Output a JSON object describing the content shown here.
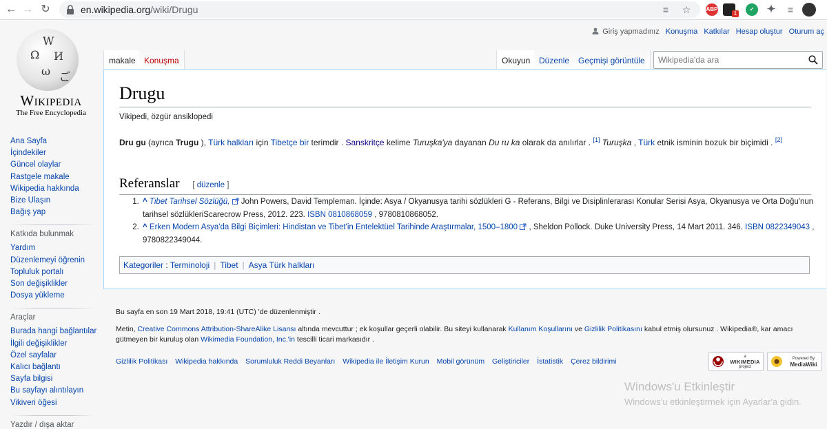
{
  "browser": {
    "url_host": "en.wikipedia.org",
    "url_path": "/wiki/Drugu",
    "extensions": {
      "abp": "ABP",
      "badge_count": "1"
    }
  },
  "logo": {
    "wordmark": "Wikipedia",
    "tagline": "The Free Encyclopedia"
  },
  "personal": {
    "not_logged_in": "Giriş yapmadınız",
    "items": [
      "Konuşma",
      "Katkılar",
      "Hesap oluştur",
      "Oturum aç"
    ]
  },
  "tabs": {
    "left": [
      "makale",
      "Konuşma"
    ],
    "right": [
      "Okuyun",
      "Düzenle",
      "Geçmişi görüntüle"
    ]
  },
  "search": {
    "placeholder": "Wikipedia'da ara"
  },
  "sidebar": {
    "nav": [
      "Ana Sayfa",
      "İçindekiler",
      "Güncel olaylar",
      "Rastgele makale",
      "Wikipedia hakkında",
      "Bize Ulaşın",
      "Bağış yap"
    ],
    "contribute_heading": "Katkıda bulunmak",
    "contribute": [
      "Yardım",
      "Düzenlemeyi öğrenin",
      "Topluluk portalı",
      "Son değişiklikler",
      "Dosya yükleme"
    ],
    "tools_heading": "Araçlar",
    "tools": [
      "Burada hangi bağlantılar",
      "İlgili değişiklikler",
      "Özel sayfalar",
      "Kalıcı bağlantı",
      "Sayfa bilgisi",
      "Bu sayfayı alıntılayın",
      "Vikiveri öğesi"
    ],
    "print_heading": "Yazdır / dışa aktar"
  },
  "article": {
    "title": "Drugu",
    "site_sub": "Vikipedi, özgür ansiklopedi",
    "lead": {
      "b1": "Dru gu",
      "t1": " (ayrıca ",
      "b2": "Trugu",
      "t2": " ), ",
      "l1": "Türk halkları",
      "t3": " için ",
      "l2": "Tibetçe bir",
      "t4": " terimdir . ",
      "l3": "Sanskritçe",
      "t5": " kelime ",
      "i1": "Turuşka'ya",
      "t6": " dayanan ",
      "i2": "Du ru ka",
      "t7": " olarak da anılırlar . ",
      "s1": "[1]",
      "t8": " ",
      "i3": "Turuşka",
      "t9": " , ",
      "l4": "Türk",
      "t10": " etnik isminin bozuk bir biçimidi . ",
      "s2": "[2]"
    },
    "refs_heading": "Referanslar",
    "refs_edit": "düzenle",
    "refs": [
      {
        "caret": "^",
        "link": "Tibet Tarihsel Sözlüğü,",
        "text": " John Powers, David Templeman. İçinde: Asya / Okyanusya tarihi sözlükleri G - Referans, Bilgi ve Disiplinlerarası Konular Serisi Asya, Okyanusya ve Orta Doğu'nun tarihsel sözlükleriScarecrow Press, 2012. 223. ",
        "isbn_label": "ISBN",
        "isbn": "0810868059",
        "tail": " , 9780810868052."
      },
      {
        "caret": "^",
        "link": "Erken Modern Asya'da Bilgi Biçimleri: Hindistan ve Tibet'in Entelektüel Tarihinde Araştırmalar, 1500–1800",
        "text": " , Sheldon Pollock. Duke University Press, 14 Mart 2011. 346. ",
        "isbn_label": "ISBN",
        "isbn": "0822349043",
        "tail": " , 9780822349044."
      }
    ],
    "categories_label": "Kategoriler",
    "categories": [
      "Terminoloji",
      "Tibet",
      "Asya Türk halkları"
    ]
  },
  "footer": {
    "lastmod": "Bu sayfa en son 19 Mart 2018, 19:41  (UTC) 'de düzenlenmiştir .",
    "license_pre": "Metin, ",
    "license_link": "Creative Commons Attribution-ShareAlike Lisansı",
    "license_mid": " altında mevcuttur ; ek koşullar geçerli olabilir. Bu siteyi kullanarak ",
    "terms_link": "Kullanım Koşullarını",
    "license_and": " ve ",
    "privacy_link": "Gizlilik Politikasını",
    "license_end": " kabul etmiş olursunuz . Wikipedia®, kar amacı gütmeyen bir kuruluş olan ",
    "wmf_link": "Wikimedia Foundation, Inc.'in",
    "license_tail": " tescilli ticari markasıdır .",
    "places": [
      "Gizlilik Politikası",
      "Wikipedia hakkında",
      "Sorumluluk Reddi Beyanları",
      "Wikipedia ile İletişim Kurun",
      "Mobil görünüm",
      "Geliştiriciler",
      "İstatistik",
      "Çerez bildirimi"
    ],
    "badge_wm": {
      "small": "a",
      "name": "WIKIMEDIA",
      "sub": "project"
    },
    "badge_mw": {
      "small": "Powered By",
      "name": "MediaWiki"
    }
  },
  "watermark": {
    "title": "Windows'u Etkinleştir",
    "sub": "Windows'u etkinleştirmek için Ayarlar'a gidin."
  }
}
